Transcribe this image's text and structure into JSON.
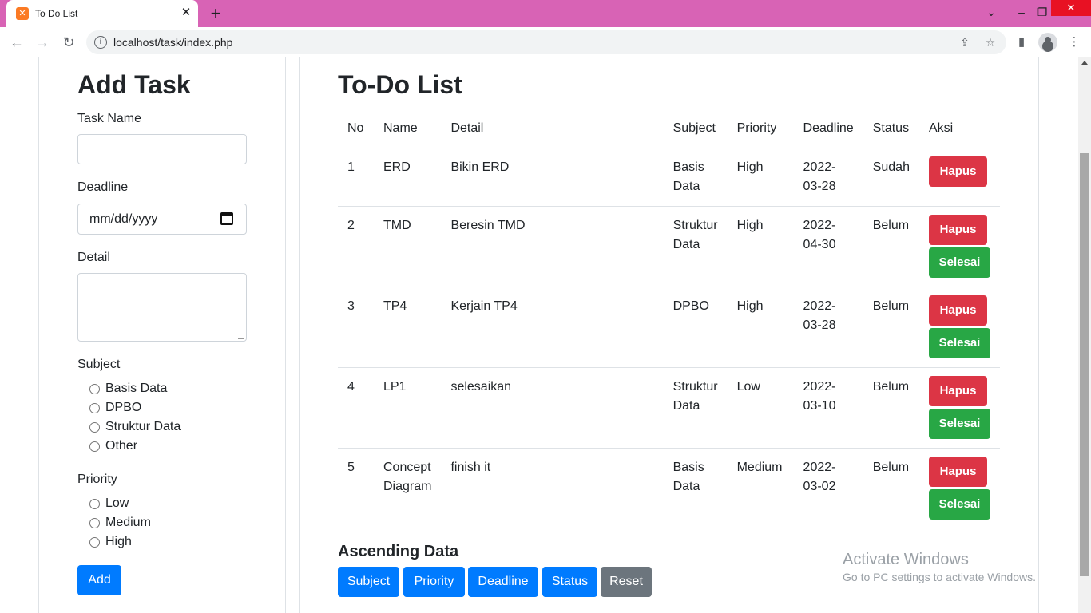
{
  "browser": {
    "tab_title": "To Do List",
    "url": "localhost/task/index.php"
  },
  "form": {
    "title": "Add Task",
    "task_name_label": "Task Name",
    "deadline_label": "Deadline",
    "deadline_placeholder": "mm/dd/yyyy",
    "detail_label": "Detail",
    "subject_label": "Subject",
    "subjects": [
      "Basis Data",
      "DPBO",
      "Struktur Data",
      "Other"
    ],
    "priority_label": "Priority",
    "priorities": [
      "Low",
      "Medium",
      "High"
    ],
    "add_button": "Add"
  },
  "list": {
    "title": "To-Do List",
    "columns": [
      "No",
      "Name",
      "Detail",
      "Subject",
      "Priority",
      "Deadline",
      "Status",
      "Aksi"
    ],
    "delete_label": "Hapus",
    "done_label": "Selesai",
    "rows": [
      {
        "no": "1",
        "name": "ERD",
        "detail": "Bikin ERD",
        "subject": "Basis Data",
        "priority": "High",
        "deadline": "2022-03-28",
        "status": "Sudah",
        "done_button": false
      },
      {
        "no": "2",
        "name": "TMD",
        "detail": "Beresin TMD",
        "subject": "Struktur Data",
        "priority": "High",
        "deadline": "2022-04-30",
        "status": "Belum",
        "done_button": true
      },
      {
        "no": "3",
        "name": "TP4",
        "detail": "Kerjain TP4",
        "subject": "DPBO",
        "priority": "High",
        "deadline": "2022-03-28",
        "status": "Belum",
        "done_button": true
      },
      {
        "no": "4",
        "name": "LP1",
        "detail": "selesaikan",
        "subject": "Struktur Data",
        "priority": "Low",
        "deadline": "2022-03-10",
        "status": "Belum",
        "done_button": true
      },
      {
        "no": "5",
        "name": "Concept Diagram",
        "detail": "finish it",
        "subject": "Basis Data",
        "priority": "Medium",
        "deadline": "2022-03-02",
        "status": "Belum",
        "done_button": true
      }
    ]
  },
  "sort": {
    "title": "Ascending Data",
    "buttons": [
      "Subject",
      "Priority",
      "Deadline",
      "Status",
      "Reset"
    ]
  },
  "watermark": {
    "line1": "Activate Windows",
    "line2": "Go to PC settings to activate Windows."
  },
  "colors": {
    "primary": "#007bff",
    "danger": "#dc3545",
    "success": "#28a745",
    "secondary": "#6c757d",
    "tabstrip": "#d863b5"
  }
}
